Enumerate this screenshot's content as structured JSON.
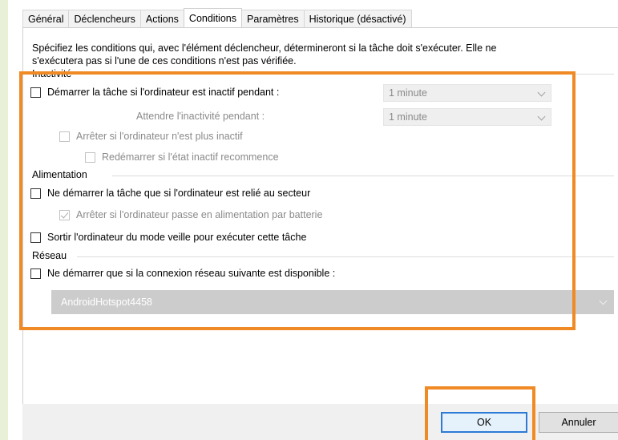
{
  "tabs": [
    {
      "label": "Général",
      "active": false
    },
    {
      "label": "Déclencheurs",
      "active": false
    },
    {
      "label": "Actions",
      "active": false
    },
    {
      "label": "Conditions",
      "active": true
    },
    {
      "label": "Paramètres",
      "active": false
    },
    {
      "label": "Historique (désactivé)",
      "active": false
    }
  ],
  "description": {
    "line1": "Spécifiez les conditions qui, avec l'élément déclencheur, détermineront si la tâche doit s'exécuter. Elle ne",
    "line2": "s'exécutera pas si l'une de ces conditions n'est pas vérifiée."
  },
  "idle": {
    "group_label": "Inactivité",
    "start_if_idle": {
      "label": "Démarrer la tâche si l'ordinateur est inactif pendant :",
      "checked": false
    },
    "idle_duration": {
      "value": "1 minute"
    },
    "wait_label": "Attendre l'inactivité pendant :",
    "wait_duration": {
      "value": "1 minute"
    },
    "stop_if_not_idle": {
      "label": "Arrêter si l'ordinateur n'est plus inactif",
      "checked": false
    },
    "restart_if_idle": {
      "label": "Redémarrer si l'état inactif recommence",
      "checked": false
    }
  },
  "power": {
    "group_label": "Alimentation",
    "ac_only": {
      "label": "Ne démarrer la tâche que si l'ordinateur est relié au secteur",
      "checked": false
    },
    "stop_on_battery": {
      "label": "Arrêter si l'ordinateur passe en alimentation par batterie",
      "checked": true
    },
    "wake_to_run": {
      "label": "Sortir l'ordinateur du mode veille pour exécuter cette tâche",
      "checked": false
    }
  },
  "network": {
    "group_label": "Réseau",
    "start_if_network": {
      "label": "Ne démarrer que si la connexion réseau suivante est disponible :",
      "checked": false
    },
    "connection": {
      "value": "AndroidHotspot4458"
    }
  },
  "buttons": {
    "ok": "OK",
    "cancel": "Annuler"
  },
  "colors": {
    "highlight": "#f08a24",
    "default_button_border": "#2d7bd5"
  }
}
